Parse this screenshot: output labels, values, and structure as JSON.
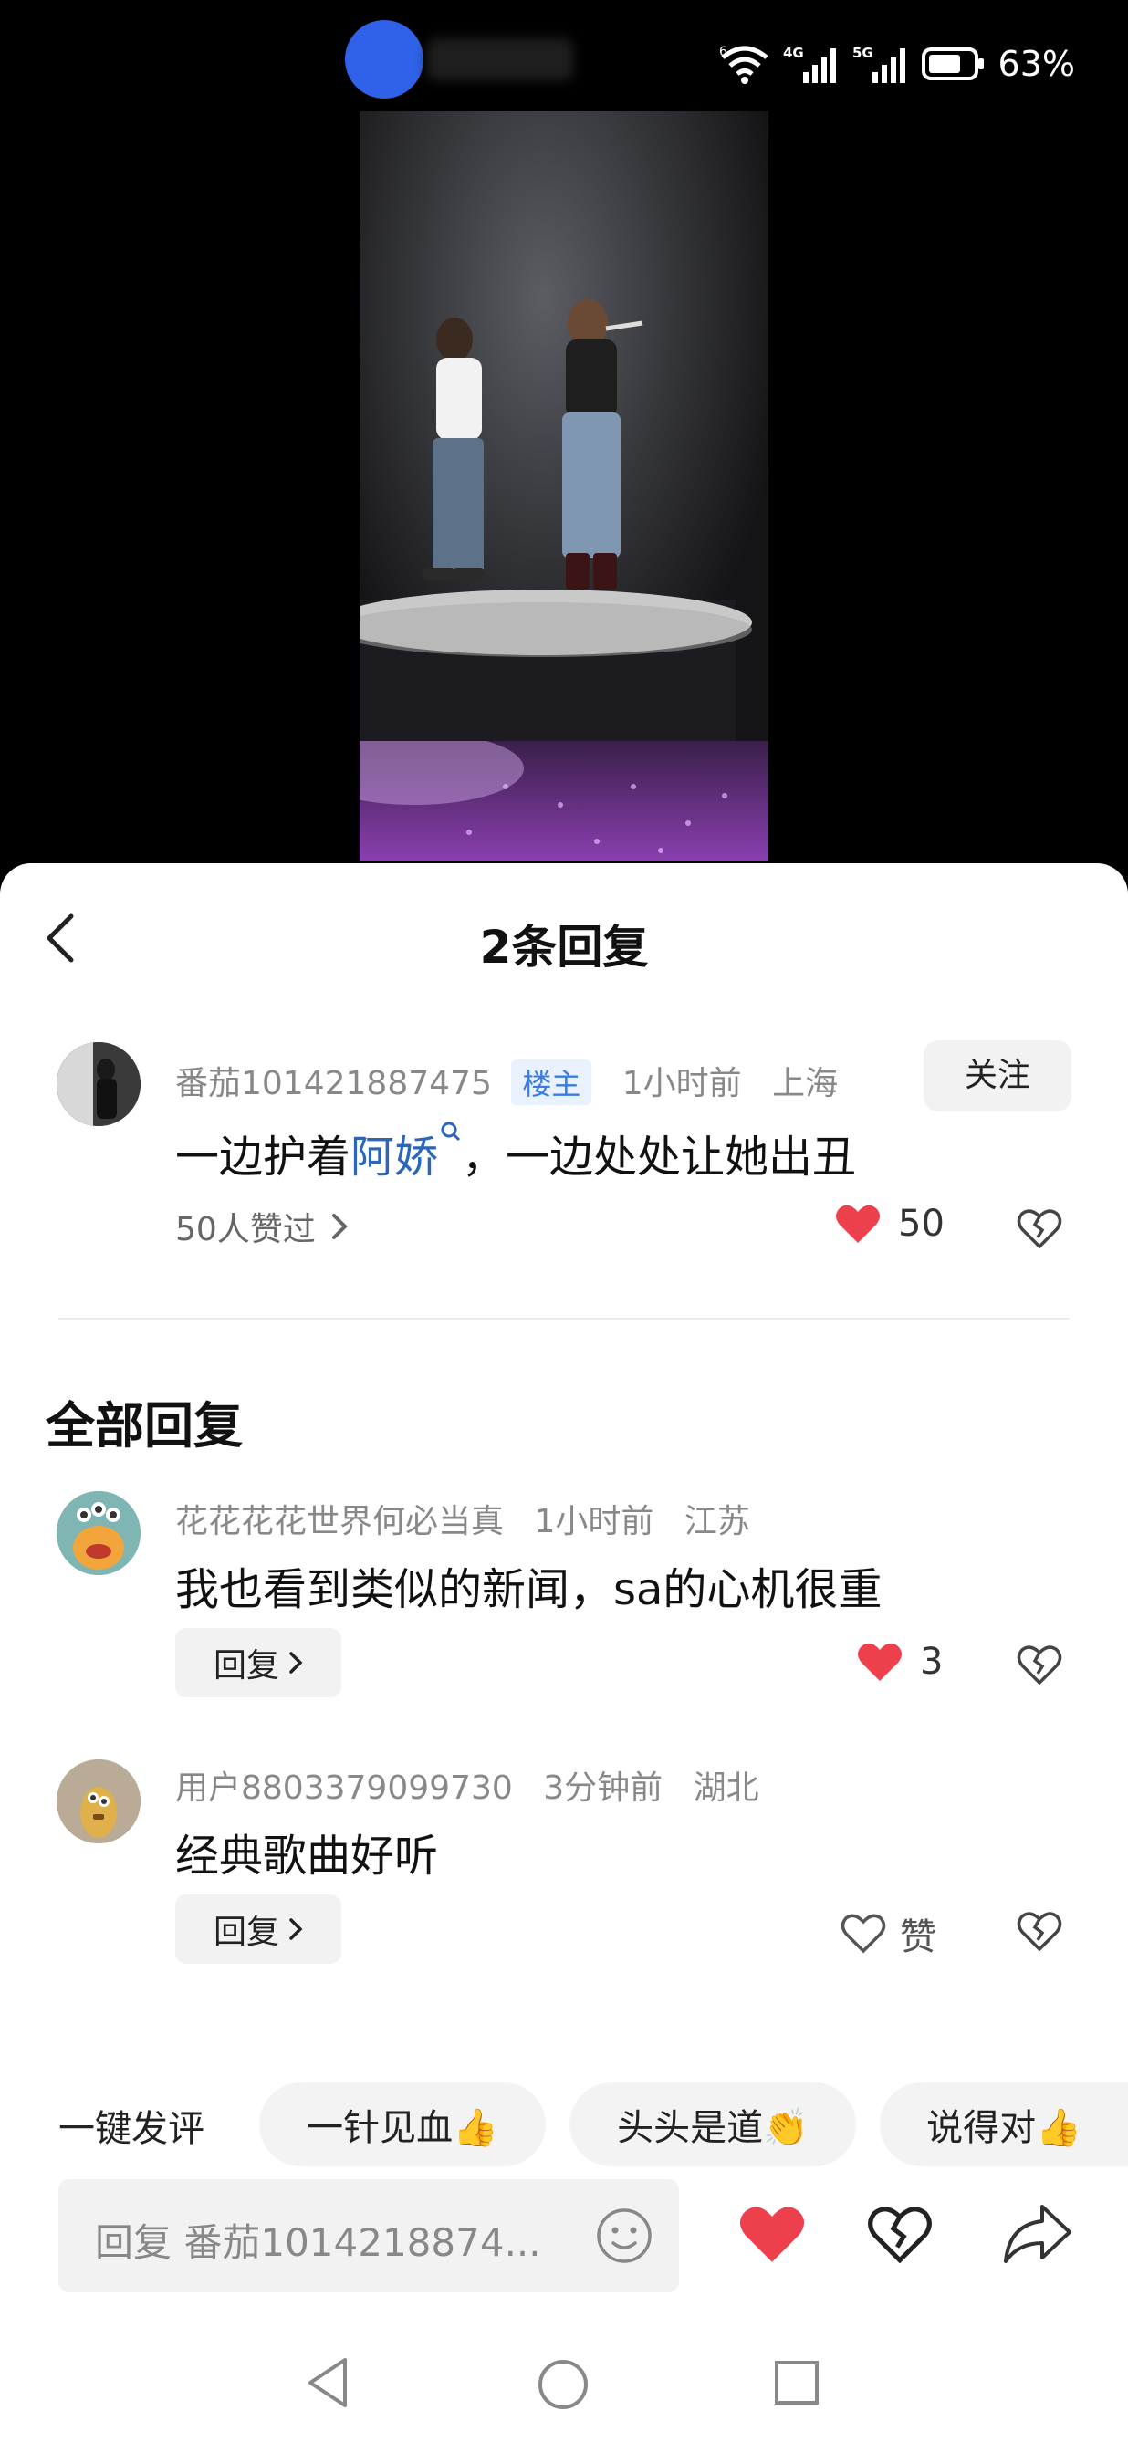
{
  "status_bar": {
    "battery_percent": "63%",
    "network_labels": [
      "6",
      "4G",
      "5G"
    ]
  },
  "sheet": {
    "title": "2条回复"
  },
  "main_comment": {
    "username": "番茄101421887475",
    "badge": "楼主",
    "time": "1小时前",
    "location": "上海",
    "follow_label": "关注",
    "text_before": "一边护着",
    "link_text": "阿娇",
    "text_after": "，一边处处让她出丑",
    "likes_summary": "50人赞过",
    "like_count": "50"
  },
  "section_title": "全部回复",
  "replies": [
    {
      "username": "花花花花世界何必当真",
      "time": "1小时前",
      "location": "江苏",
      "text": "我也看到类似的新闻，sa的心机很重",
      "reply_label": "回复",
      "like_count": "3",
      "liked": true
    },
    {
      "username": "用户8803379099730",
      "time": "3分钟前",
      "location": "湖北",
      "text": "经典歌曲好听",
      "reply_label": "回复",
      "like_label": "赞",
      "liked": false
    }
  ],
  "quick_reply": {
    "label": "一键发评",
    "chips": [
      "一针见血👍",
      "头头是道👏",
      "说得对👍"
    ]
  },
  "input": {
    "placeholder": "回复 番茄1014218874..."
  },
  "colors": {
    "accent_red": "#ee3f4d",
    "link_blue": "#2b66b8",
    "badge_blue": "#3a7ce0"
  }
}
